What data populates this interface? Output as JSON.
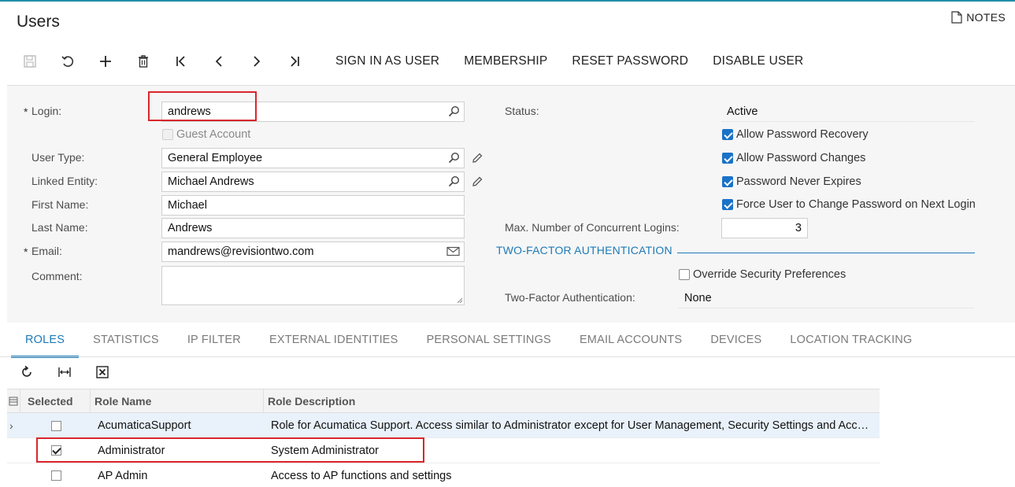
{
  "page": {
    "title": "Users",
    "notes_label": "NOTES"
  },
  "toolbar": {
    "icons": [
      "save-icon",
      "undo-icon",
      "add-icon",
      "delete-icon",
      "first-record-icon",
      "previous-record-icon",
      "next-record-icon",
      "last-record-icon"
    ],
    "actions": [
      "SIGN IN AS USER",
      "MEMBERSHIP",
      "RESET PASSWORD",
      "DISABLE USER"
    ]
  },
  "form": {
    "login": {
      "label": "Login:",
      "value": "andrews"
    },
    "guest_account": {
      "label": "Guest Account",
      "checked": false
    },
    "user_type": {
      "label": "User Type:",
      "value": "General Employee"
    },
    "linked_entity": {
      "label": "Linked Entity:",
      "value": "Michael Andrews"
    },
    "first_name": {
      "label": "First Name:",
      "value": "Michael"
    },
    "last_name": {
      "label": "Last Name:",
      "value": "Andrews"
    },
    "email": {
      "label": "Email:",
      "value": "mandrews@revisiontwo.com"
    },
    "comment": {
      "label": "Comment:",
      "value": ""
    },
    "required_mark": "*",
    "status": {
      "label": "Status:",
      "value": "Active"
    },
    "checks": [
      {
        "label": "Allow Password Recovery",
        "checked": true
      },
      {
        "label": "Allow Password Changes",
        "checked": true
      },
      {
        "label": "Password Never Expires",
        "checked": true
      },
      {
        "label": "Force User to Change Password on Next Login",
        "checked": true
      }
    ],
    "max_logins": {
      "label": "Max. Number of Concurrent Logins:",
      "value": "3"
    },
    "two_factor_section": "TWO-FACTOR AUTHENTICATION",
    "override_security": {
      "label": "Override Security Preferences",
      "checked": false
    },
    "two_factor": {
      "label": "Two-Factor Authentication:",
      "value": "None"
    }
  },
  "tabs": [
    "ROLES",
    "STATISTICS",
    "IP FILTER",
    "EXTERNAL IDENTITIES",
    "PERSONAL SETTINGS",
    "EMAIL ACCOUNTS",
    "DEVICES",
    "LOCATION TRACKING"
  ],
  "active_tab": "ROLES",
  "grid": {
    "tools": [
      "refresh-icon",
      "fit-columns-icon",
      "export-excel-icon"
    ],
    "columns": [
      "Selected",
      "Role Name",
      "Role Description"
    ],
    "rows": [
      {
        "selected": false,
        "name": "AcumaticaSupport",
        "description": "Role for Acumatica Support. Access similar to Administrator except for User Management, Security Settings and Access Rights."
      },
      {
        "selected": true,
        "name": "Administrator",
        "description": "System Administrator"
      },
      {
        "selected": false,
        "name": "AP Admin",
        "description": "Access to AP functions and settings"
      }
    ]
  },
  "colors": {
    "accent": "#1c7ab8",
    "highlight": "#d9262c",
    "checkbox": "#1a73c7"
  }
}
